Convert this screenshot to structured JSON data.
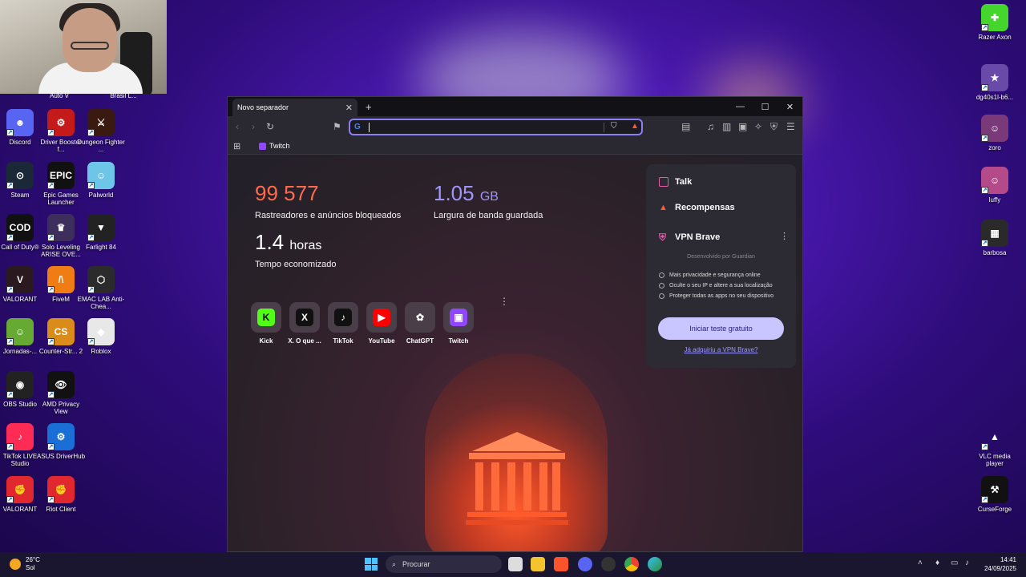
{
  "webcam_cut_labels": [
    "Auto V",
    "Brasil L..."
  ],
  "desktop_left": [
    {
      "label": "Discord",
      "bg": "#5865f2",
      "glyph": "☻"
    },
    {
      "label": "Driver Booster f...",
      "bg": "#c41a1a",
      "glyph": "⚙"
    },
    {
      "label": "Dungeon Fighter ...",
      "bg": "#3a1a10",
      "glyph": "⚔"
    },
    {
      "label": "Steam",
      "bg": "#1b2838",
      "glyph": "⊙"
    },
    {
      "label": "Epic Games Launcher",
      "bg": "#111",
      "glyph": "EPIC"
    },
    {
      "label": "Palworld",
      "bg": "#6dc6e8",
      "glyph": "☺"
    },
    {
      "label": "Call of Duty®",
      "bg": "#111",
      "glyph": "COD"
    },
    {
      "label": "Solo Leveling ARISE OVE...",
      "bg": "#3d2e5c",
      "glyph": "♛"
    },
    {
      "label": "Farlight 84",
      "bg": "#222",
      "glyph": "▼"
    },
    {
      "label": "VALORANT",
      "bg": "#2a1a1f",
      "glyph": "V"
    },
    {
      "label": "FiveM",
      "bg": "#f07d14",
      "glyph": "/\\"
    },
    {
      "label": "EMAC LAB Anti-Chea...",
      "bg": "#2b2b2b",
      "glyph": "⬡"
    },
    {
      "label": "Jornadas-...",
      "bg": "#6a3",
      "glyph": "☺"
    },
    {
      "label": "Counter-Str... 2",
      "bg": "#d98c1a",
      "glyph": "CS"
    },
    {
      "label": "Roblox",
      "bg": "#e8e8e8",
      "glyph": "◆"
    },
    {
      "label": "OBS Studio",
      "bg": "#222",
      "glyph": "◉"
    },
    {
      "label": "AMD Privacy View",
      "bg": "#111",
      "glyph": "👁"
    },
    {
      "label": "",
      "bg": "transparent",
      "glyph": ""
    },
    {
      "label": "TikTok LIVE Studio",
      "bg": "#fe2c55",
      "glyph": "♪"
    },
    {
      "label": "ASUS DriverHub",
      "bg": "#1a6fd6",
      "glyph": "⚙"
    },
    {
      "label": "",
      "bg": "transparent",
      "glyph": ""
    },
    {
      "label": "VALORANT",
      "bg": "#e0282e",
      "glyph": "✊"
    },
    {
      "label": "Riot Client",
      "bg": "#e0282e",
      "glyph": "✊"
    }
  ],
  "desktop_right": [
    {
      "label": "Razer Axon",
      "bg": "#44d62c",
      "glyph": "✚"
    },
    {
      "label": "dg40s1l-b6...",
      "bg": "#6a4aa8",
      "glyph": "★"
    },
    {
      "label": "zoro",
      "bg": "#7a3a7a",
      "glyph": "☺"
    },
    {
      "label": "luffy",
      "bg": "#b54a8a",
      "glyph": "☺"
    },
    {
      "label": "barbosa",
      "bg": "#2a2a2a",
      "glyph": "▦"
    },
    {
      "label": "VLC media player",
      "bg": "transparent",
      "glyph": "▲"
    },
    {
      "label": "CurseForge",
      "bg": "#111",
      "glyph": "⚒"
    }
  ],
  "browser": {
    "tab_title": "Novo separador",
    "bookmark": "Twitch",
    "stats": {
      "blocked_value": "99 577",
      "blocked_label": "Rastreadores e anúncios bloqueados",
      "bandwidth_value": "1.05",
      "bandwidth_unit": "GB",
      "bandwidth_label": "Largura de banda guardada",
      "time_value": "1.4",
      "time_unit": "horas",
      "time_label": "Tempo economizado"
    },
    "tiles": [
      {
        "label": "Kick",
        "color": "#53fc18",
        "fg": "#000",
        "glyph": "K"
      },
      {
        "label": "X. O que ...",
        "color": "#111",
        "fg": "#fff",
        "glyph": "X"
      },
      {
        "label": "TikTok",
        "color": "#111",
        "fg": "#fff",
        "glyph": "♪"
      },
      {
        "label": "YouTube",
        "color": "#ff0000",
        "fg": "#fff",
        "glyph": "▶"
      },
      {
        "label": "ChatGPT",
        "color": "transparent",
        "fg": "#fff",
        "glyph": "✿"
      },
      {
        "label": "Twitch",
        "color": "#9146ff",
        "fg": "#fff",
        "glyph": "▣"
      }
    ],
    "panel": {
      "talk": "Talk",
      "rewards": "Recompensas",
      "vpn": "VPN Brave",
      "dev": "Desenvolvido por  Guardian",
      "features": [
        "Mais privacidade e segurança online",
        "Oculte o seu IP e altere a sua localização",
        "Proteger todas as apps no seu dispositivo"
      ],
      "trial_button": "Iniciar teste gratuito",
      "already": "Já adquiriu a VPN Brave?"
    }
  },
  "taskbar": {
    "temp": "26°C",
    "weather": "Sol",
    "search_placeholder": "Procurar",
    "time": "14:41",
    "date": "24/09/2025"
  }
}
